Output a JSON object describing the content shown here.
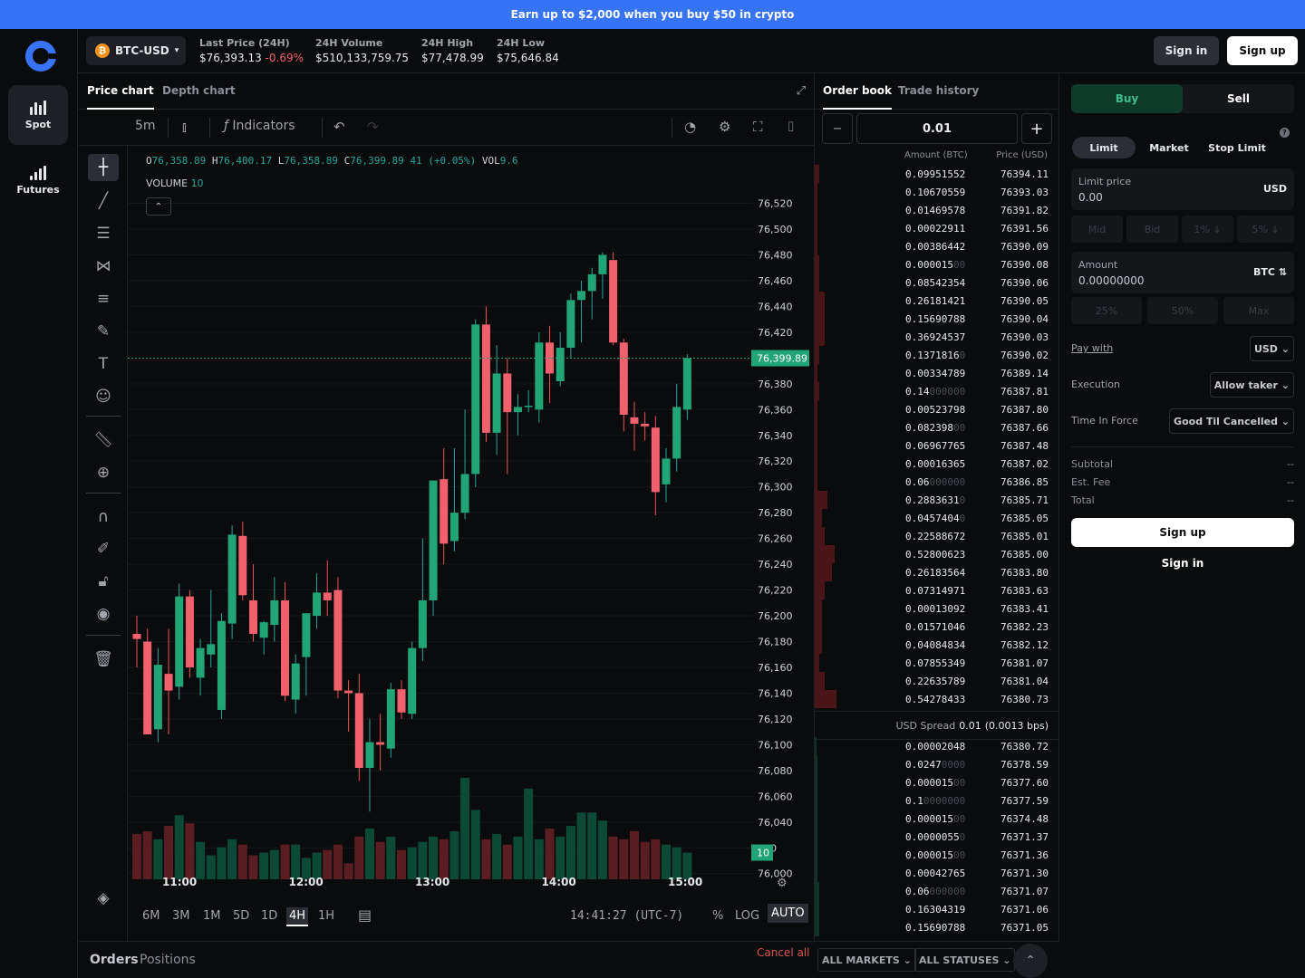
{
  "banner": {
    "text": "Earn up to $2,000 when you buy $50 in crypto"
  },
  "nav": {
    "spot": "Spot",
    "futures": "Futures"
  },
  "header": {
    "pair": "BTC-USD",
    "last_price_label": "Last Price (24H)",
    "last_price": "$76,393.13",
    "change": "-0.69%",
    "volume_label": "24H Volume",
    "volume": "$510,133,759.75",
    "high_label": "24H High",
    "high": "$77,478.99",
    "low_label": "24H Low",
    "low": "$75,646.84",
    "signin": "Sign in",
    "signup": "Sign up"
  },
  "chart_tabs": {
    "price": "Price chart",
    "depth": "Depth chart"
  },
  "chart_toolbar": {
    "interval": "5m",
    "indicators": "Indicators"
  },
  "legend": {
    "o_label": "O",
    "o": "76,358.89",
    "h_label": "H",
    "h": "76,400.17",
    "l_label": "L",
    "l": "76,358.89",
    "c_label": "C",
    "c": "76,399.89",
    "change": "41 (+0.05%)",
    "vol_label": "VOL",
    "vol": "9.6",
    "volume_label": "VOLUME",
    "volume": "10"
  },
  "chart_data": {
    "type": "candlestick",
    "x_ticks": [
      "11:00",
      "12:00",
      "13:00",
      "14:00",
      "15:00"
    ],
    "y_ticks": [
      76520,
      76500,
      76480,
      76460,
      76440,
      76420,
      76380,
      76360,
      76340,
      76320,
      76300,
      76280,
      76260,
      76240,
      76220,
      76200,
      76180,
      76160,
      76140,
      76120,
      76100,
      76080,
      76060,
      76040,
      76020,
      76000
    ],
    "y_tick_labels": [
      "76,520",
      "76,500",
      "76,480",
      "76,460",
      "76,440",
      "76,420",
      "76,380",
      "76,360",
      "76,340",
      "76,320",
      "76,300",
      "76,280",
      "76,260",
      "76,240",
      "76,220",
      "76,200",
      "76,180",
      "76,160",
      "76,140",
      "76,120",
      "76,100",
      "76,080",
      "76,060",
      "76,040",
      "020",
      "76,000"
    ],
    "ylim": [
      75997,
      76552
    ],
    "last_price_label": "76,399.89",
    "last_price": 76399.89,
    "volume_label": "10",
    "volume_value": 10,
    "volume_max": 38,
    "candles": [
      {
        "o": 76186,
        "h": 76200,
        "l": 76160,
        "c": 76182,
        "v": 17
      },
      {
        "o": 76180,
        "h": 76190,
        "l": 76110,
        "c": 76108,
        "v": 18
      },
      {
        "o": 76112,
        "h": 76175,
        "l": 76102,
        "c": 76162,
        "v": 15
      },
      {
        "o": 76155,
        "h": 76190,
        "l": 76108,
        "c": 76142,
        "v": 20
      },
      {
        "o": 76145,
        "h": 76225,
        "l": 76135,
        "c": 76215,
        "v": 24
      },
      {
        "o": 76215,
        "h": 76220,
        "l": 76152,
        "c": 76160,
        "v": 21
      },
      {
        "o": 76152,
        "h": 76182,
        "l": 76138,
        "c": 76175,
        "v": 14
      },
      {
        "o": 76170,
        "h": 76220,
        "l": 76160,
        "c": 76178,
        "v": 9
      },
      {
        "o": 76127,
        "h": 76202,
        "l": 76120,
        "c": 76196,
        "v": 12
      },
      {
        "o": 76194,
        "h": 76270,
        "l": 76182,
        "c": 76263,
        "v": 15
      },
      {
        "o": 76262,
        "h": 76273,
        "l": 76212,
        "c": 76216,
        "v": 13
      },
      {
        "o": 76212,
        "h": 76240,
        "l": 76180,
        "c": 76186,
        "v": 9
      },
      {
        "o": 76183,
        "h": 76196,
        "l": 76170,
        "c": 76195,
        "v": 10
      },
      {
        "o": 76193,
        "h": 76230,
        "l": 76180,
        "c": 76212,
        "v": 11
      },
      {
        "o": 76212,
        "h": 76226,
        "l": 76134,
        "c": 76138,
        "v": 13
      },
      {
        "o": 76135,
        "h": 76170,
        "l": 76124,
        "c": 76163,
        "v": 13
      },
      {
        "o": 76168,
        "h": 76200,
        "l": 76138,
        "c": 76202,
        "v": 8
      },
      {
        "o": 76200,
        "h": 76233,
        "l": 76190,
        "c": 76218,
        "v": 10
      },
      {
        "o": 76218,
        "h": 76243,
        "l": 76200,
        "c": 76212,
        "v": 11
      },
      {
        "o": 76220,
        "h": 76230,
        "l": 76136,
        "c": 76142,
        "v": 13
      },
      {
        "o": 76142,
        "h": 76150,
        "l": 76110,
        "c": 76140,
        "v": 6
      },
      {
        "o": 76140,
        "h": 76155,
        "l": 76072,
        "c": 76082,
        "v": 16
      },
      {
        "o": 76082,
        "h": 76120,
        "l": 76048,
        "c": 76102,
        "v": 19
      },
      {
        "o": 76102,
        "h": 76124,
        "l": 76080,
        "c": 76100,
        "v": 14
      },
      {
        "o": 76097,
        "h": 76148,
        "l": 76090,
        "c": 76143,
        "v": 16
      },
      {
        "o": 76143,
        "h": 76150,
        "l": 76120,
        "c": 76125,
        "v": 11
      },
      {
        "o": 76124,
        "h": 76180,
        "l": 76120,
        "c": 76175,
        "v": 12
      },
      {
        "o": 76175,
        "h": 76260,
        "l": 76165,
        "c": 76212,
        "v": 14
      },
      {
        "o": 76212,
        "h": 76305,
        "l": 76200,
        "c": 76305,
        "v": 16
      },
      {
        "o": 76306,
        "h": 76330,
        "l": 76240,
        "c": 76256,
        "v": 15
      },
      {
        "o": 76258,
        "h": 76330,
        "l": 76250,
        "c": 76280,
        "v": 18
      },
      {
        "o": 76280,
        "h": 76360,
        "l": 76275,
        "c": 76310,
        "v": 38
      },
      {
        "o": 76310,
        "h": 76430,
        "l": 76300,
        "c": 76426,
        "v": 26
      },
      {
        "o": 76426,
        "h": 76440,
        "l": 76335,
        "c": 76342,
        "v": 15
      },
      {
        "o": 76342,
        "h": 76410,
        "l": 76325,
        "c": 76388,
        "v": 17
      },
      {
        "o": 76388,
        "h": 76400,
        "l": 76310,
        "c": 76358,
        "v": 13
      },
      {
        "o": 76358,
        "h": 76372,
        "l": 76340,
        "c": 76362,
        "v": 16
      },
      {
        "o": 76362,
        "h": 76375,
        "l": 76358,
        "c": 76363,
        "v": 34
      },
      {
        "o": 76360,
        "h": 76420,
        "l": 76350,
        "c": 76412,
        "v": 15
      },
      {
        "o": 76412,
        "h": 76425,
        "l": 76365,
        "c": 76388,
        "v": 19
      },
      {
        "o": 76382,
        "h": 76420,
        "l": 76378,
        "c": 76408,
        "v": 16
      },
      {
        "o": 76408,
        "h": 76450,
        "l": 76400,
        "c": 76445,
        "v": 20
      },
      {
        "o": 76445,
        "h": 76460,
        "l": 76412,
        "c": 76452,
        "v": 25
      },
      {
        "o": 76452,
        "h": 76470,
        "l": 76430,
        "c": 76465,
        "v": 25
      },
      {
        "o": 76465,
        "h": 76482,
        "l": 76446,
        "c": 76480,
        "v": 22
      },
      {
        "o": 76476,
        "h": 76482,
        "l": 76410,
        "c": 76412,
        "v": 16
      },
      {
        "o": 76412,
        "h": 76415,
        "l": 76343,
        "c": 76356,
        "v": 15
      },
      {
        "o": 76354,
        "h": 76366,
        "l": 76328,
        "c": 76349,
        "v": 18
      },
      {
        "o": 76349,
        "h": 76358,
        "l": 76336,
        "c": 76347,
        "v": 14
      },
      {
        "o": 76346,
        "h": 76355,
        "l": 76278,
        "c": 76296,
        "v": 15
      },
      {
        "o": 76302,
        "h": 76330,
        "l": 76288,
        "c": 76322,
        "v": 13
      },
      {
        "o": 76322,
        "h": 76380,
        "l": 76312,
        "c": 76362,
        "v": 12
      },
      {
        "o": 76360,
        "h": 76403,
        "l": 76352,
        "c": 76400,
        "v": 10
      }
    ]
  },
  "chart_ranges": [
    "6M",
    "3M",
    "1M",
    "5D",
    "1D",
    "4H",
    "1H"
  ],
  "chart_status": {
    "clock": "14:41:27 (UTC-7)",
    "percent": "%",
    "log": "LOG",
    "auto": "AUTO"
  },
  "orderbook": {
    "tab_book": "Order book",
    "tab_history": "Trade history",
    "minus": "−",
    "step": "0.01",
    "plus": "+",
    "col_amount": "Amount (BTC)",
    "col_price": "Price (USD)",
    "asks": [
      {
        "amount": "0.09951552",
        "dim": "",
        "price": "76394.11",
        "depth": 0.02
      },
      {
        "amount": "0.10670559",
        "dim": "",
        "price": "76393.03",
        "depth": 0.01
      },
      {
        "amount": "0.01469578",
        "dim": "",
        "price": "76391.82",
        "depth": 0.01
      },
      {
        "amount": "0.00022911",
        "dim": "",
        "price": "76391.56",
        "depth": 0.01
      },
      {
        "amount": "0.00386442",
        "dim": "",
        "price": "76390.09",
        "depth": 0.01
      },
      {
        "amount": "0.000015",
        "dim": "00",
        "price": "76390.08",
        "depth": 0.02
      },
      {
        "amount": "0.08542354",
        "dim": "",
        "price": "76390.06",
        "depth": 0.02
      },
      {
        "amount": "0.26181421",
        "dim": "",
        "price": "76390.05",
        "depth": 0.04
      },
      {
        "amount": "0.15690788",
        "dim": "",
        "price": "76390.04",
        "depth": 0.04
      },
      {
        "amount": "0.36924537",
        "dim": "",
        "price": "76390.03",
        "depth": 0.04
      },
      {
        "amount": "0.1371816",
        "dim": "0",
        "price": "76390.02",
        "depth": 0.02
      },
      {
        "amount": "0.00334789",
        "dim": "",
        "price": "76389.14",
        "depth": 0.01
      },
      {
        "amount": "0.14",
        "dim": "000000",
        "price": "76387.81",
        "depth": 0.02
      },
      {
        "amount": "0.00523798",
        "dim": "",
        "price": "76387.80",
        "depth": 0.01
      },
      {
        "amount": "0.082398",
        "dim": "00",
        "price": "76387.66",
        "depth": 0.01
      },
      {
        "amount": "0.06967765",
        "dim": "",
        "price": "76387.48",
        "depth": 0.01
      },
      {
        "amount": "0.00016365",
        "dim": "",
        "price": "76387.02",
        "depth": 0.01
      },
      {
        "amount": "0.06",
        "dim": "000000",
        "price": "76386.85",
        "depth": 0.01
      },
      {
        "amount": "0.2883631",
        "dim": "0",
        "price": "76385.71",
        "depth": 0.05
      },
      {
        "amount": "0.0457404",
        "dim": "0",
        "price": "76385.05",
        "depth": 0.03
      },
      {
        "amount": "0.22588672",
        "dim": "",
        "price": "76385.01",
        "depth": 0.04
      },
      {
        "amount": "0.52800623",
        "dim": "",
        "price": "76385.00",
        "depth": 0.08
      },
      {
        "amount": "0.26183564",
        "dim": "",
        "price": "76383.80",
        "depth": 0.07
      },
      {
        "amount": "0.07314971",
        "dim": "",
        "price": "76383.63",
        "depth": 0.04
      },
      {
        "amount": "0.00013092",
        "dim": "",
        "price": "76383.41",
        "depth": 0.03
      },
      {
        "amount": "0.01571046",
        "dim": "",
        "price": "76382.23",
        "depth": 0.03
      },
      {
        "amount": "0.04084834",
        "dim": "",
        "price": "76382.12",
        "depth": 0.03
      },
      {
        "amount": "0.07855349",
        "dim": "",
        "price": "76381.07",
        "depth": 0.02
      },
      {
        "amount": "0.22635789",
        "dim": "",
        "price": "76381.04",
        "depth": 0.04
      },
      {
        "amount": "0.54278433",
        "dim": "",
        "price": "76380.73",
        "depth": 0.09
      }
    ],
    "spread_label": "USD Spread",
    "spread_value": "0.01",
    "spread_bps": "(0.0013 bps)",
    "bids": [
      {
        "amount": "0.00002048",
        "dim": "",
        "price": "76380.72",
        "depth": 0.0
      },
      {
        "amount": "0.0247",
        "dim": "0000",
        "price": "76378.59",
        "depth": 0.01
      },
      {
        "amount": "0.000015",
        "dim": "00",
        "price": "76377.60",
        "depth": 0.01
      },
      {
        "amount": "0.1",
        "dim": "0000000",
        "price": "76377.59",
        "depth": 0.01
      },
      {
        "amount": "0.000015",
        "dim": "00",
        "price": "76374.48",
        "depth": 0.01
      },
      {
        "amount": "0.0000055",
        "dim": "0",
        "price": "76371.37",
        "depth": 0.01
      },
      {
        "amount": "0.000015",
        "dim": "00",
        "price": "76371.36",
        "depth": 0.01
      },
      {
        "amount": "0.00042765",
        "dim": "",
        "price": "76371.30",
        "depth": 0.01
      },
      {
        "amount": "0.06",
        "dim": "000000",
        "price": "76371.07",
        "depth": 0.02
      },
      {
        "amount": "0.16304319",
        "dim": "",
        "price": "76371.06",
        "depth": 0.02
      },
      {
        "amount": "0.15690788",
        "dim": "",
        "price": "76371.05",
        "depth": 0.02
      }
    ]
  },
  "trade": {
    "buy": "Buy",
    "sell": "Sell",
    "order_types": [
      "Limit",
      "Market",
      "Stop Limit"
    ],
    "help": "?",
    "limit_price_label": "Limit price",
    "limit_price_value": "0.00",
    "limit_price_unit": "USD",
    "price_chips": [
      "Mid",
      "Bid",
      "1% ↓",
      "5% ↓"
    ],
    "amount_label": "Amount",
    "amount_value": "0.00000000",
    "amount_unit": "BTC ⇅",
    "amount_chips": [
      "25%",
      "50%",
      "Max"
    ],
    "pay_with_label": "Pay with",
    "pay_with_value": "USD ⌄",
    "execution_label": "Execution",
    "execution_value": "Allow taker ⌄",
    "tif_label": "Time In Force",
    "tif_value": "Good Til Cancelled ⌄",
    "subtotal_label": "Subtotal",
    "subtotal_value": "--",
    "fee_label": "Est. Fee",
    "fee_value": "--",
    "total_label": "Total",
    "total_value": "--",
    "signup": "Sign up",
    "signin": "Sign in"
  },
  "footer": {
    "orders": "Orders",
    "positions": "Positions",
    "cancel_all": "Cancel all",
    "markets": "ALL MARKETS ⌄",
    "statuses": "ALL STATUSES ⌄",
    "up": "⌃"
  },
  "colors": {
    "up": "#26a69a",
    "down": "#ef5350",
    "accent": "#3773f5",
    "ask_depth": "#4a1518",
    "bid_depth": "#0f3326"
  }
}
